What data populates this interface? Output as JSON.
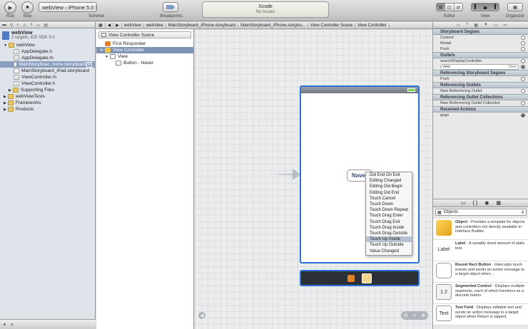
{
  "toolbar": {
    "run_label": "Run",
    "stop_label": "Stop",
    "scheme_target": "webView",
    "scheme_sep": "›",
    "scheme_device": "iPhone 5.0 Simulator",
    "scheme_label": "Scheme",
    "breakpoints_label": "Breakpoints",
    "status_title": "Xcode",
    "status_sub": "No Issues",
    "editor_label": "Editor",
    "view_label": "View",
    "organizer_label": "Organizer"
  },
  "navigator": {
    "project_name": "webView",
    "project_sub": "2 targets, iOS SDK 5.0",
    "items": [
      {
        "label": "webView"
      },
      {
        "label": "AppDelegate.h"
      },
      {
        "label": "AppDelegate.m"
      },
      {
        "label": "MainStoryboar...hone.storyboard"
      },
      {
        "label": "MainStoryboard_iPad.storyboard"
      },
      {
        "label": "ViewController.m"
      },
      {
        "label": "ViewController.h"
      },
      {
        "label": "Supporting Files"
      },
      {
        "label": "webViewTests"
      },
      {
        "label": "Frameworks"
      },
      {
        "label": "Products"
      }
    ]
  },
  "jumpbar": {
    "crumbs": [
      "webView",
      "webView",
      "MainStoryboard_iPhone.storyboard",
      "MainStoryboard_iPhone.storybo...",
      "View Controller Scene",
      "View Controller"
    ]
  },
  "scene": {
    "header": "View Controller Scene",
    "items": [
      {
        "label": "First Responder"
      },
      {
        "label": "View Controller"
      },
      {
        "label": "View"
      },
      {
        "label": "Button - Naver"
      }
    ]
  },
  "canvas": {
    "button_text": "Naver",
    "menu": [
      "Did End On Exit",
      "Editing Changed",
      "Editing Did Begin",
      "Editing Did End",
      "Touch Cancel",
      "Touch Down",
      "Touch Down Repeat",
      "Touch Drag Enter",
      "Touch Drag Exit",
      "Touch Drag Inside",
      "Touch Drag Outside",
      "Touch Up Inside",
      "Touch Up Outside",
      "Value Changed"
    ],
    "menu_selected": "Touch Up Inside"
  },
  "inspector": {
    "sections": [
      {
        "title": "Storyboard Segues",
        "rows": [
          "Custom",
          "Modal",
          "Push"
        ]
      },
      {
        "title": "Outlets",
        "rows": [
          "searchDisplayController"
        ]
      },
      {
        "title": "Referencing Storyboard Segues",
        "rows": [
          "Push"
        ]
      },
      {
        "title": "Referencing Outlets",
        "rows": [
          "New Referencing Outlet"
        ]
      },
      {
        "title": "Referencing Outlet Collections",
        "rows": [
          "New Referencing Outlet Collection"
        ]
      },
      {
        "title": "Received Actions",
        "rows": [
          "gogo"
        ]
      }
    ],
    "outlet_view": "view",
    "outlet_view_target": "View"
  },
  "library": {
    "selector": "Objects",
    "items": [
      {
        "icon": "",
        "name": "Object",
        "desc": " - Provides a template for objects and controllers not directly available in Interface Builder."
      },
      {
        "icon": "Label",
        "name": "Label",
        "desc": " - A variably sized amount of static text."
      },
      {
        "icon": "",
        "name": "Round Rect Button",
        "desc": " - Intercepts touch events and sends an action message to a target object when..."
      },
      {
        "icon": "1 2",
        "name": "Segmented Control",
        "desc": " - Displays multiple segments, each of which functions as a discrete button."
      },
      {
        "icon": "Text",
        "name": "Text Field",
        "desc": " - Displays editable text and sends an action message to a target object when Return is tapped."
      }
    ]
  }
}
